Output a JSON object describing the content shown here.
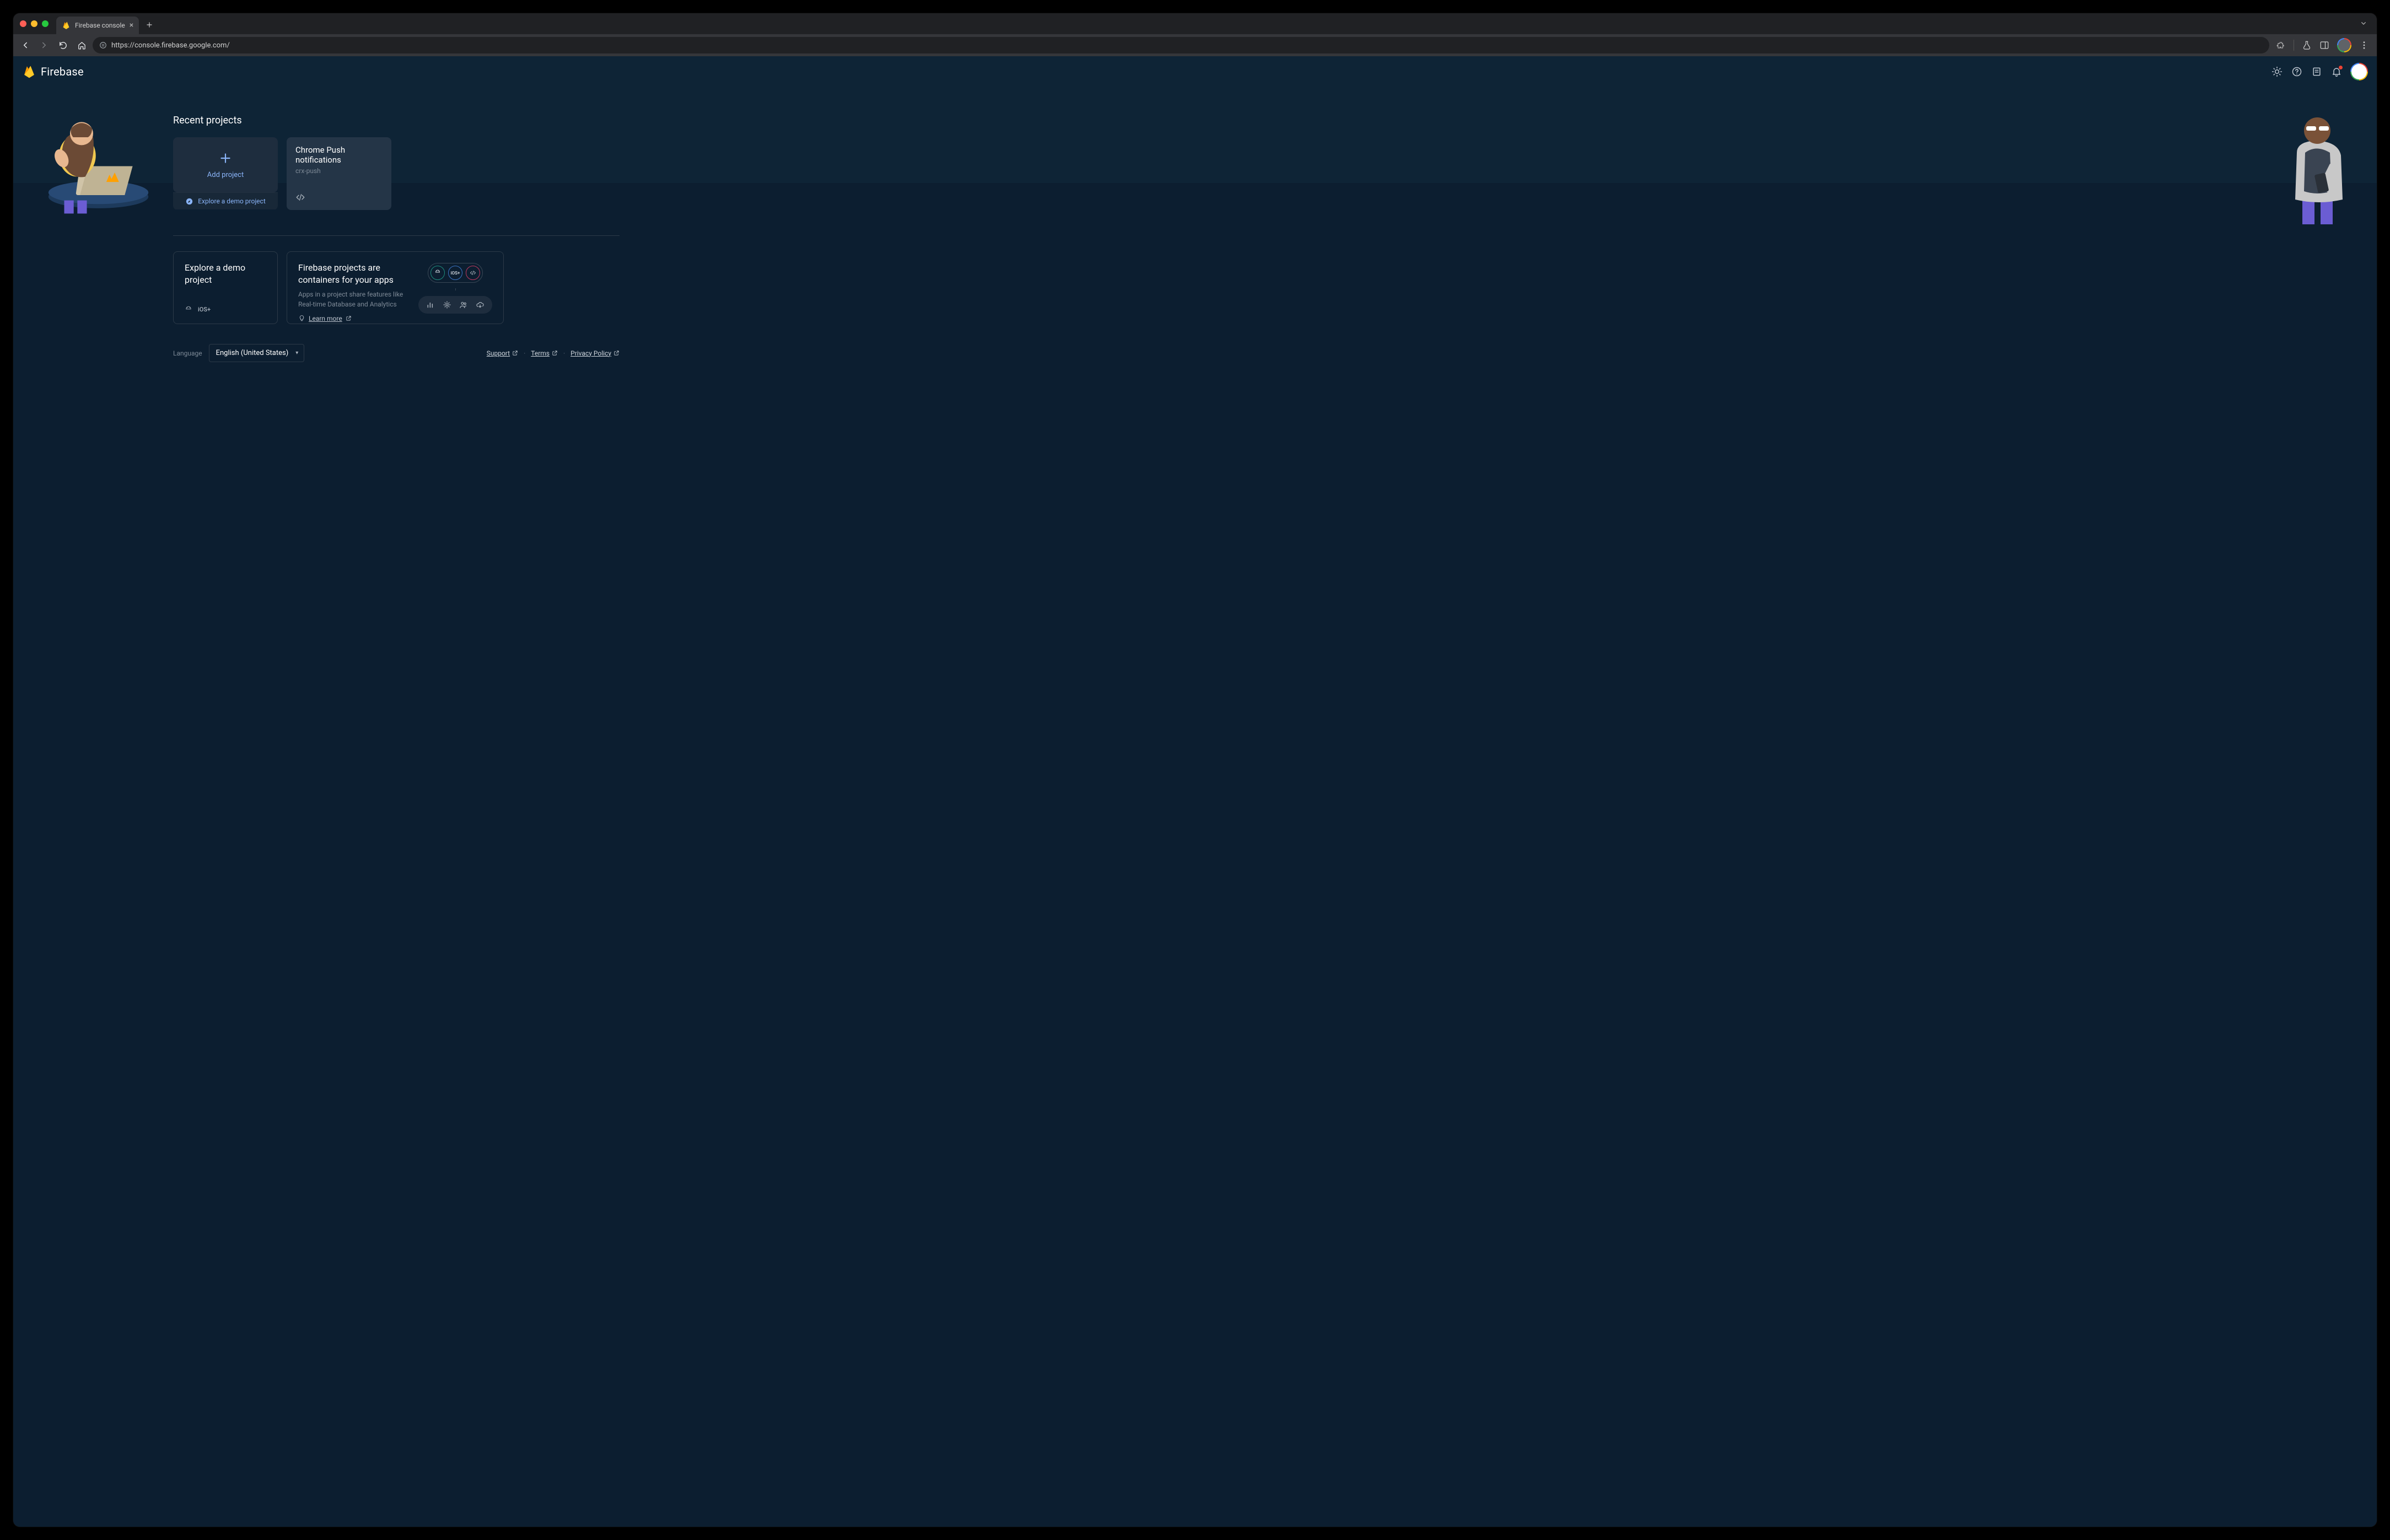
{
  "browser": {
    "tab_title": "Firebase console",
    "url": "https://console.firebase.google.com/"
  },
  "header": {
    "brand": "Firebase"
  },
  "recent": {
    "title": "Recent projects",
    "add_label": "Add project",
    "demo_label": "Explore a demo project",
    "projects": [
      {
        "name": "Chrome Push notifications",
        "id": "crx-push"
      }
    ]
  },
  "explore_card": {
    "title": "Explore a demo project"
  },
  "containers_card": {
    "title": "Firebase projects are containers for your apps",
    "desc": "Apps in a project share features like Real-time Database and Analytics",
    "learn_more": "Learn more",
    "ios_label": "iOS+"
  },
  "footer": {
    "language_label": "Language",
    "language_value": "English (United States)",
    "support": "Support",
    "terms": "Terms",
    "privacy": "Privacy Policy"
  }
}
